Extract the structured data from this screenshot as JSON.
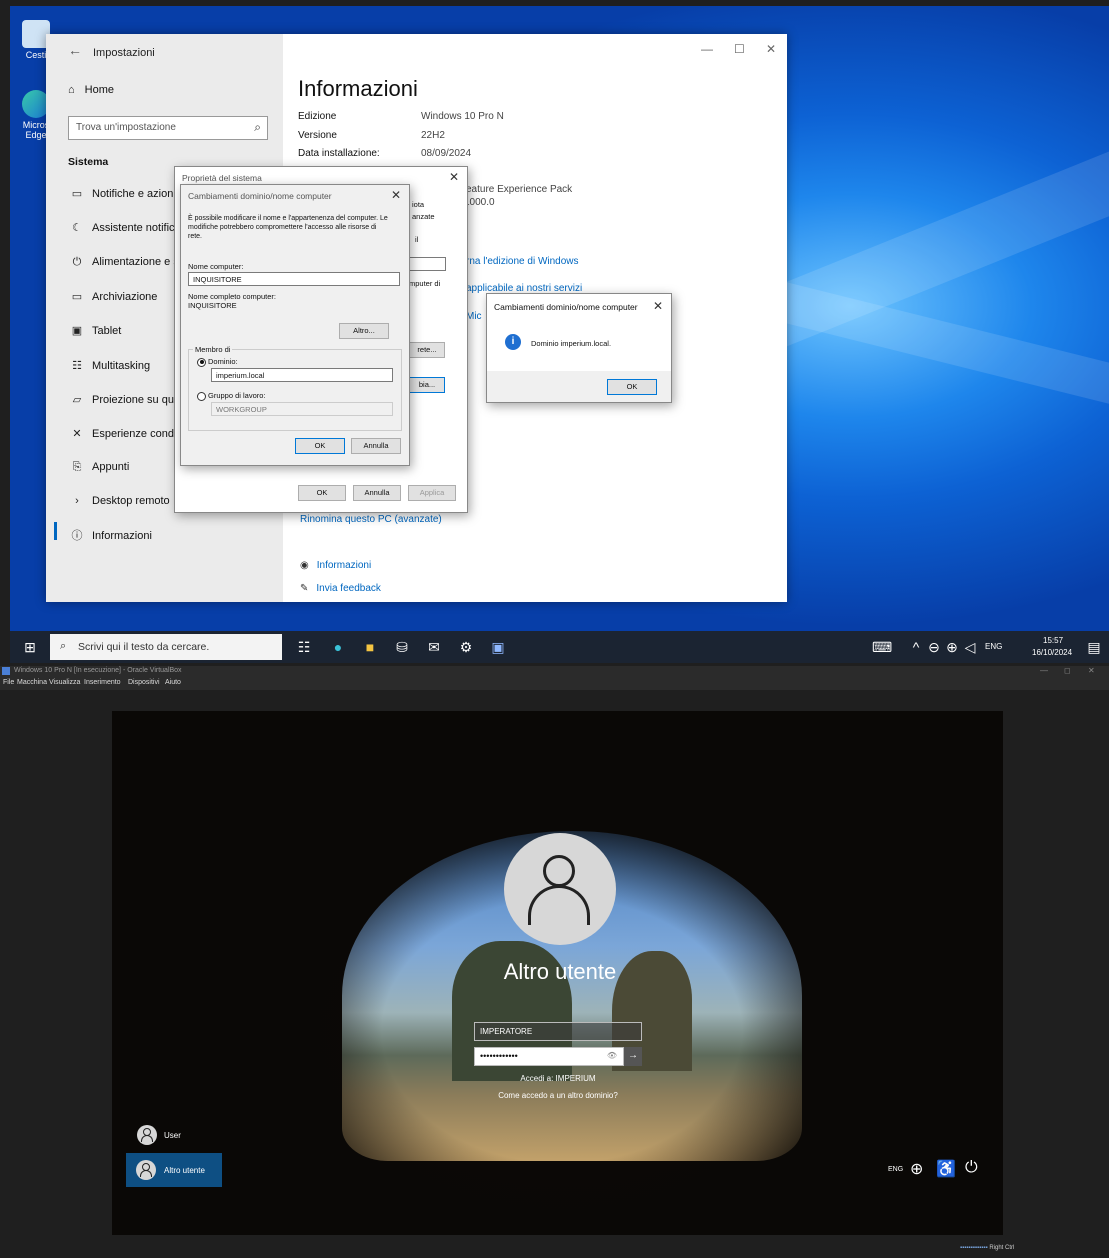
{
  "desktop": {
    "icons": [
      {
        "label": "Cesti"
      },
      {
        "label": "Micros Edge"
      }
    ]
  },
  "settings": {
    "window_title": "Impostazioni",
    "home": "Home",
    "search_placeholder": "Trova un'impostazione",
    "section": "Sistema",
    "nav": [
      {
        "label": "Notifiche e azioni",
        "icon": "message-icon"
      },
      {
        "label": "Assistente notifiche",
        "icon": "moon-icon"
      },
      {
        "label": "Alimentazione e sos",
        "icon": "power-icon"
      },
      {
        "label": "Archiviazione",
        "icon": "storage-icon"
      },
      {
        "label": "Tablet",
        "icon": "tablet-icon"
      },
      {
        "label": "Multitasking",
        "icon": "multitasking-icon"
      },
      {
        "label": "Proiezione su quest",
        "icon": "projection-icon"
      },
      {
        "label": "Esperienze condivis",
        "icon": "shared-icon"
      },
      {
        "label": "Appunti",
        "icon": "clipboard-icon"
      },
      {
        "label": "Desktop remoto",
        "icon": "remote-icon"
      },
      {
        "label": "Informazioni",
        "icon": "info-icon",
        "selected": true
      }
    ],
    "page_title": "Informazioni",
    "specs": [
      {
        "label": "Edizione",
        "value": "Windows 10 Pro N"
      },
      {
        "label": "Versione",
        "value": "22H2"
      },
      {
        "label": "Data installazione:",
        "value": "08/09/2024"
      }
    ],
    "partial_text": {
      "experience": "eature Experience Pack",
      "version_tail": "1000.0",
      "upgrade_link": "rna l'edizione di Windows",
      "services_link": "applicabile ai nostri servizi",
      "mic": "Mic"
    },
    "rename_link": "Rinomina questo PC (avanzate)",
    "help_links": [
      "Informazioni",
      "Invia feedback"
    ]
  },
  "sysprops": {
    "title": "Proprietà del sistema",
    "tab_tail_1": "iota",
    "tab_tail_2": "anzate",
    "text_il": "il",
    "computer_di": "mputer di",
    "rete_button": "rete...",
    "cambia_button": "bia...",
    "ok": "OK",
    "annulla": "Annulla",
    "applica": "Applica"
  },
  "domain_dialog": {
    "title": "Cambiamenti dominio/nome computer",
    "description_lines": [
      "È possibile modificare il nome e l'appartenenza del computer. Le",
      "modifiche potrebbero compromettere l'accesso alle risorse di",
      "rete."
    ],
    "computer_name_label": "Nome computer:",
    "computer_name_value": "INQUISITORE",
    "full_name_label": "Nome completo computer:",
    "full_name_value": "INQUISITORE",
    "more_button": "Altro...",
    "member_of": "Membro di",
    "domain_label": "Dominio:",
    "domain_value": "imperium.local",
    "workgroup_label": "Gruppo di lavoro:",
    "workgroup_value": "WORKGROUP",
    "ok": "OK",
    "cancel": "Annulla"
  },
  "message_box": {
    "title": "Cambiamenti dominio/nome computer",
    "message": "Dominio imperium.local.",
    "ok": "OK"
  },
  "taskbar": {
    "search_placeholder": "Scrivi qui il testo da cercare.",
    "lang": "ENG",
    "time": "15:57",
    "date": "16/10/2024"
  },
  "virtualbox": {
    "title": "Windows 10 Pro N [In esecuzione] - Oracle VirtualBox",
    "menu": [
      "File",
      "Macchina",
      "Visualizza",
      "Inserimento",
      "Dispositivi",
      "Aiuto"
    ],
    "status_right": "Right Ctrl"
  },
  "login": {
    "user_display": "Altro utente",
    "username_value": "IMPERATORE",
    "password_mask": "••••••••••••",
    "sign_in_to": "Accedi a: IMPERIUM",
    "other_domain_link": "Come accedo a un altro dominio?",
    "users": [
      {
        "label": "User"
      },
      {
        "label": "Altro utente",
        "selected": true
      }
    ],
    "lang": "ENG"
  },
  "colors": {
    "accent": "#0067c0",
    "desktop_blue": "#1e86ec",
    "taskbar": "#1b2432",
    "selected_user": "#0e4f83"
  }
}
